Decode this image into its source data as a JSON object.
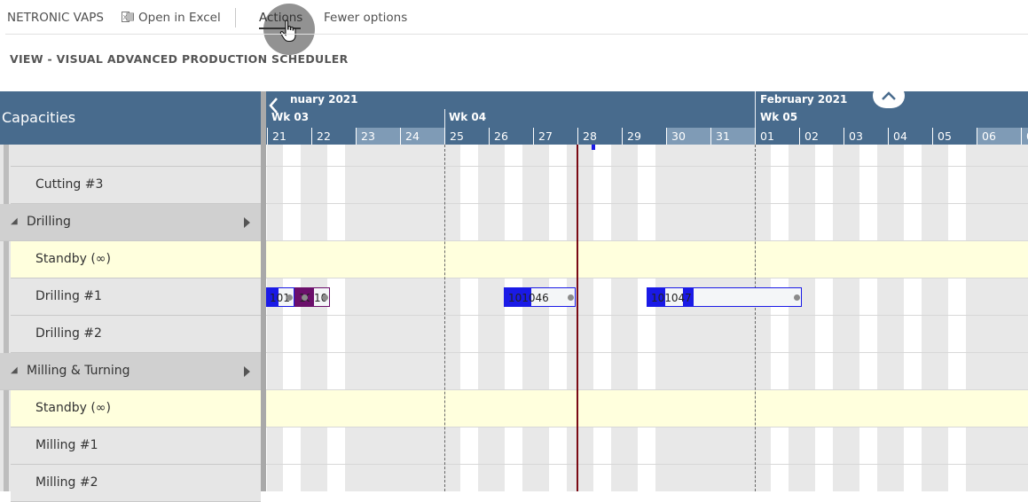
{
  "toolbar": {
    "app_name": "NETRONIC VAPS",
    "open_excel": "Open in Excel",
    "actions": "Actions",
    "fewer_options": "Fewer options"
  },
  "view_title": "VIEW - VISUAL ADVANCED PRODUCTION SCHEDULER",
  "left_header": "Capacities",
  "timeline": {
    "months": [
      {
        "label": "nuary 2021"
      },
      {
        "label": "February 2021"
      }
    ],
    "weeks": [
      {
        "label": "Wk 03"
      },
      {
        "label": "Wk 04"
      },
      {
        "label": "Wk 05"
      }
    ],
    "days": [
      {
        "label": "21",
        "weekend": false
      },
      {
        "label": "22",
        "weekend": false
      },
      {
        "label": "23",
        "weekend": true
      },
      {
        "label": "24",
        "weekend": true
      },
      {
        "label": "25",
        "weekend": false
      },
      {
        "label": "26",
        "weekend": false
      },
      {
        "label": "27",
        "weekend": false
      },
      {
        "label": "28",
        "weekend": false
      },
      {
        "label": "29",
        "weekend": false
      },
      {
        "label": "30",
        "weekend": true
      },
      {
        "label": "31",
        "weekend": true
      },
      {
        "label": "01",
        "weekend": false
      },
      {
        "label": "02",
        "weekend": false
      },
      {
        "label": "03",
        "weekend": false
      },
      {
        "label": "04",
        "weekend": false
      },
      {
        "label": "05",
        "weekend": false
      },
      {
        "label": "06",
        "weekend": true
      },
      {
        "label": "0",
        "weekend": true
      }
    ]
  },
  "rows": [
    {
      "label": "",
      "type": "resource"
    },
    {
      "label": "Cutting #3",
      "type": "resource"
    },
    {
      "label": "Drilling",
      "type": "group"
    },
    {
      "label": "Standby (∞)",
      "type": "standby"
    },
    {
      "label": "Drilling #1",
      "type": "resource"
    },
    {
      "label": "Drilling #2",
      "type": "resource"
    },
    {
      "label": "Milling & Turning",
      "type": "group"
    },
    {
      "label": "Standby (∞)",
      "type": "standby"
    },
    {
      "label": "Milling #1",
      "type": "resource"
    },
    {
      "label": "Milling #2",
      "type": "resource"
    }
  ],
  "bars": [
    {
      "row": 4,
      "label": "101",
      "start_day": 20.96,
      "end_day": 21.62,
      "fill": "#1a1ae6",
      "progress": 0.45
    },
    {
      "row": 4,
      "label": "10",
      "start_day": 21.62,
      "end_day": 21.96,
      "fill": "#6b0f6b",
      "progress": 1
    },
    {
      "row": 4,
      "label": "10",
      "start_day": 21.96,
      "end_day": 22.42,
      "fill": "#6b0f6b",
      "progress": 0.2
    },
    {
      "row": 4,
      "label": "101046",
      "start_day": 26.34,
      "end_day": 27.96,
      "fill": "#1a1ae6",
      "progress": 0.6
    },
    {
      "row": 4,
      "label": "101047",
      "start_day": 29.56,
      "end_day": 33.06,
      "fill": "#1a1ae6",
      "progress": 0.3
    }
  ],
  "colors": {
    "header_bg": "#486b8d",
    "group_bg": "#d0d0d0",
    "resource_bg": "#e6e6e6",
    "standby_bg": "#ffffdd",
    "bar_blue": "#1a1ae6",
    "bar_purple": "#6b0f6b",
    "now_line": "#7a0a14"
  }
}
